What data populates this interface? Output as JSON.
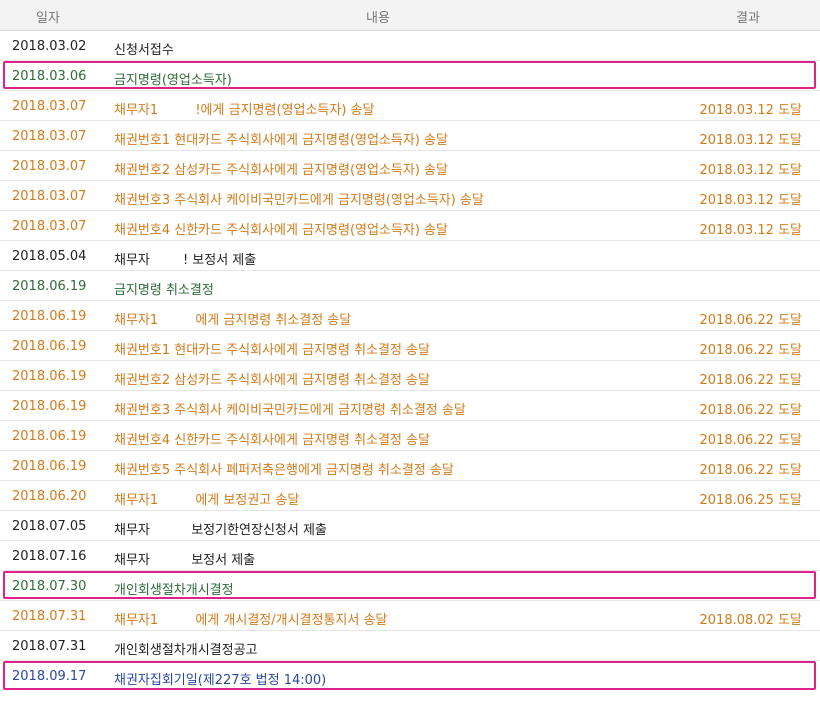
{
  "header": {
    "date": "일자",
    "content": "내용",
    "result": "결과"
  },
  "colors": {
    "dark": "#222222",
    "green": "#2f6b3a",
    "orange": "#d27b1b",
    "blue": "#2b47a6",
    "highlight": "#e0218a"
  },
  "rows": [
    {
      "date": "2018.03.02",
      "content": "신청서접수",
      "result": "",
      "style": "dark",
      "highlight": false
    },
    {
      "date": "2018.03.06",
      "content": "금지명령(영업소득자)",
      "result": "",
      "style": "green",
      "highlight": true
    },
    {
      "date": "2018.03.07",
      "content": "채무자1         !에게 금지명령(영업소득자) 송달",
      "result": "2018.03.12 도달",
      "style": "orange",
      "highlight": false
    },
    {
      "date": "2018.03.07",
      "content": "채권번호1 현대카드 주식회사에게 금지명령(영업소득자) 송달",
      "result": "2018.03.12 도달",
      "style": "orange",
      "highlight": false
    },
    {
      "date": "2018.03.07",
      "content": "채권번호2 삼성카드 주식회사에게 금지명령(영업소득자) 송달",
      "result": "2018.03.12 도달",
      "style": "orange",
      "highlight": false
    },
    {
      "date": "2018.03.07",
      "content": "채권번호3 주식회사 케이비국민카드에게 금지명령(영업소득자) 송달",
      "result": "2018.03.12 도달",
      "style": "orange",
      "highlight": false
    },
    {
      "date": "2018.03.07",
      "content": "채권번호4 신한카드 주식회사에게 금지명령(영업소득자) 송달",
      "result": "2018.03.12 도달",
      "style": "orange",
      "highlight": false
    },
    {
      "date": "2018.05.04",
      "content": "채무자        ! 보정서 제출",
      "result": "",
      "style": "dark",
      "highlight": false
    },
    {
      "date": "2018.06.19",
      "content": "금지명령 취소결정",
      "result": "",
      "style": "green",
      "highlight": false
    },
    {
      "date": "2018.06.19",
      "content": "채무자1         에게 금지명령 취소결정 송달",
      "result": "2018.06.22 도달",
      "style": "orange",
      "highlight": false
    },
    {
      "date": "2018.06.19",
      "content": "채권번호1 현대카드 주식회사에게 금지명령 취소결정 송달",
      "result": "2018.06.22 도달",
      "style": "orange",
      "highlight": false
    },
    {
      "date": "2018.06.19",
      "content": "채권번호2 삼성카드 주식회사에게 금지명령 취소결정 송달",
      "result": "2018.06.22 도달",
      "style": "orange",
      "highlight": false
    },
    {
      "date": "2018.06.19",
      "content": "채권번호3 주식회사 케이비국민카드에게 금지명령 취소결정 송달",
      "result": "2018.06.22 도달",
      "style": "orange",
      "highlight": false
    },
    {
      "date": "2018.06.19",
      "content": "채권번호4 신한카드 주식회사에게 금지명령 취소결정 송달",
      "result": "2018.06.22 도달",
      "style": "orange",
      "highlight": false
    },
    {
      "date": "2018.06.19",
      "content": "채권번호5 주식회사 페퍼저축은행에게 금지명령 취소결정 송달",
      "result": "2018.06.22 도달",
      "style": "orange",
      "highlight": false
    },
    {
      "date": "2018.06.20",
      "content": "채무자1         에게 보정권고 송달",
      "result": "2018.06.25 도달",
      "style": "orange",
      "highlight": false
    },
    {
      "date": "2018.07.05",
      "content": "채무자          보정기한연장신청서 제출",
      "result": "",
      "style": "dark",
      "highlight": false
    },
    {
      "date": "2018.07.16",
      "content": "채무자          보정서 제출",
      "result": "",
      "style": "dark",
      "highlight": false
    },
    {
      "date": "2018.07.30",
      "content": "개인회생절차개시결정",
      "result": "",
      "style": "green",
      "highlight": true
    },
    {
      "date": "2018.07.31",
      "content": "채무자1         에게 개시결정/개시결정통지서 송달",
      "result": "2018.08.02 도달",
      "style": "orange",
      "highlight": false
    },
    {
      "date": "2018.07.31",
      "content": "개인회생절차개시결정공고",
      "result": "",
      "style": "dark",
      "highlight": false
    },
    {
      "date": "2018.09.17",
      "content": "채권자집회기일(제227호 법정 14:00)",
      "result": "",
      "style": "blue",
      "highlight": true
    }
  ]
}
